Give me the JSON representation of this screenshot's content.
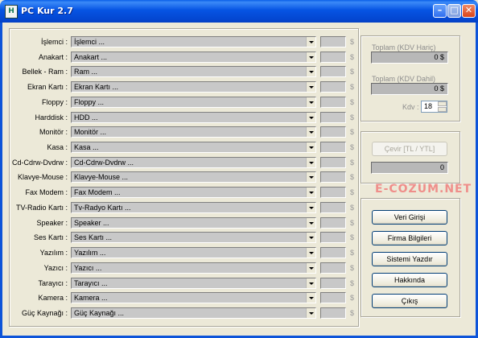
{
  "window": {
    "title": "PC Kur 2.7",
    "app_icon_glyph": "H"
  },
  "rows": [
    {
      "label": "İşlemci :",
      "value": "İşlemci ..."
    },
    {
      "label": "Anakart :",
      "value": "Anakart ..."
    },
    {
      "label": "Bellek - Ram :",
      "value": "Ram ..."
    },
    {
      "label": "Ekran Kartı :",
      "value": "Ekran Kartı ..."
    },
    {
      "label": "Floppy :",
      "value": "Floppy ..."
    },
    {
      "label": "Harddisk :",
      "value": "HDD ..."
    },
    {
      "label": "Monitör :",
      "value": "Monitör ..."
    },
    {
      "label": "Kasa :",
      "value": "Kasa ..."
    },
    {
      "label": "Cd-Cdrw-Dvdrw :",
      "value": "Cd-Cdrw-Dvdrw ..."
    },
    {
      "label": "Klavye-Mouse :",
      "value": "Klavye-Mouse ..."
    },
    {
      "label": "Fax Modem :",
      "value": "Fax Modem ..."
    },
    {
      "label": "TV-Radio Kartı :",
      "value": "Tv-Radyo Kartı ..."
    },
    {
      "label": "Speaker :",
      "value": "Speaker ..."
    },
    {
      "label": "Ses Kartı :",
      "value": "Ses Kartı ..."
    },
    {
      "label": "Yazılım :",
      "value": "Yazılım ..."
    },
    {
      "label": "Yazıcı :",
      "value": "Yazıcı ..."
    },
    {
      "label": "Tarayıcı :",
      "value": "Tarayıcı ..."
    },
    {
      "label": "Kamera :",
      "value": "Kamera ..."
    },
    {
      "label": "Güç Kaynağı :",
      "value": "Güç Kaynağı ..."
    }
  ],
  "currency_symbol": "$",
  "totals": {
    "excl_label": "Toplam (KDV Hariç)",
    "excl_value": "0 $",
    "incl_label": "Toplam (KDV Dahil)",
    "incl_value": "0 $",
    "kdv_label": "Kdv :",
    "kdv_value": "18"
  },
  "convert": {
    "button_label": "Çevir [TL / YTL]",
    "value": "0"
  },
  "watermark": "E-COZUM.NET",
  "actions": {
    "data_entry": "Veri Girişi",
    "company_info": "Firma Bilgileri",
    "print_system": "Sistemi Yazdır",
    "about": "Hakkında",
    "exit": "Çıkış"
  },
  "colors": {
    "titlebar": "#0654e3",
    "window_bg": "#ece9d8",
    "field_bg": "#c8c8c8",
    "watermark": "#f07070"
  }
}
